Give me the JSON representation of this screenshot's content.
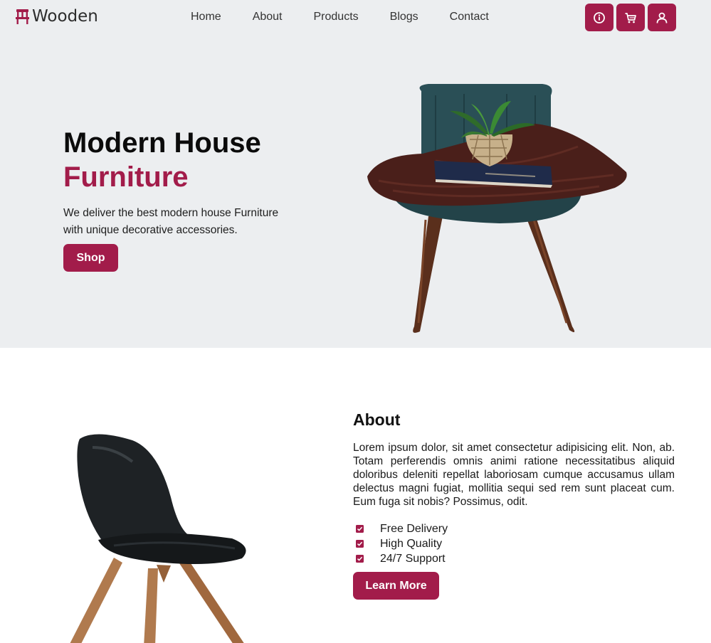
{
  "brand": {
    "name": "Wooden",
    "logo_icon": "chair-icon",
    "accent_color": "#a21c4a"
  },
  "nav": {
    "items": [
      {
        "label": "Home"
      },
      {
        "label": "About"
      },
      {
        "label": "Products"
      },
      {
        "label": "Blogs"
      },
      {
        "label": "Contact"
      }
    ],
    "buttons": [
      {
        "icon": "info-icon"
      },
      {
        "icon": "cart-icon"
      },
      {
        "icon": "user-icon"
      }
    ]
  },
  "hero": {
    "title_line1": "Modern House",
    "title_line2": "Furniture",
    "description": "We deliver the best modern house Furniture with unique decorative accessories.",
    "cta_label": "Shop",
    "image": "velvet-chair-with-plant-image"
  },
  "about": {
    "title": "About",
    "text": "Lorem ipsum dolor, sit amet consectetur adipisicing elit. Non, ab. Totam perferendis omnis animi ratione necessitatibus aliquid doloribus deleniti repellat laboriosam cumque accusamus ullam delectus magni fugiat, mollitia sequi sed rem sunt placeat cum. Eum fuga sit nobis? Possimus, odit.",
    "features": [
      {
        "label": "Free Delivery",
        "icon": "check-icon"
      },
      {
        "label": "High Quality",
        "icon": "check-icon"
      },
      {
        "label": "24/7 Support",
        "icon": "check-icon"
      }
    ],
    "cta_label": "Learn More",
    "image": "black-chair-image"
  }
}
